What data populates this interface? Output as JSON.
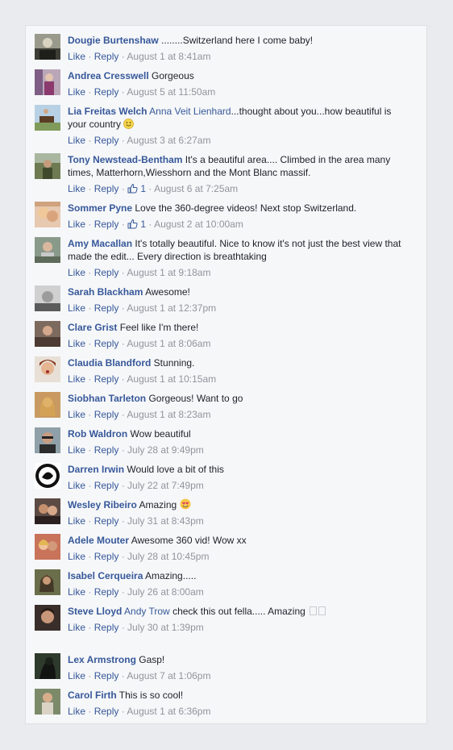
{
  "comments": [
    {
      "author": "Dougie Burtenshaw",
      "text": " ........Switzerland here I come baby!",
      "like": "Like",
      "reply": "Reply",
      "time": "August 1 at 8:41am"
    },
    {
      "author": "Andrea Cresswell",
      "text": " Gorgeous",
      "like": "Like",
      "reply": "Reply",
      "time": "August 5 at 11:50am"
    },
    {
      "author": "Lia Freitas Welch",
      "mention": "Anna Veit Lienhard",
      "text": "...thought about you...how beautiful is your country",
      "emoji": "smile-emoji",
      "like": "Like",
      "reply": "Reply",
      "time": "August 3 at 6:27am"
    },
    {
      "author": "Tony Newstead-Bentham",
      "text": " It's a beautiful area.... Climbed in the area many times, Matterhorn,Wiesshorn and the Mont Blanc massif.",
      "like": "Like",
      "reply": "Reply",
      "likes": "1",
      "time": "August 6 at 7:25am"
    },
    {
      "author": "Sommer Pyne",
      "text": " Love the 360-degree videos! Next stop Switzerland.",
      "like": "Like",
      "reply": "Reply",
      "likes": "1",
      "time": "August 2 at 10:00am"
    },
    {
      "author": "Amy Macallan",
      "text": " It's totally beautiful. Nice to know it's not just the best view that made the edit... Every direction is breathtaking",
      "like": "Like",
      "reply": "Reply",
      "time": "August 1 at 9:18am"
    },
    {
      "author": "Sarah Blackham",
      "text": " Awesome!",
      "like": "Like",
      "reply": "Reply",
      "time": "August 1 at 12:37pm"
    },
    {
      "author": "Clare Grist",
      "text": " Feel like I'm there!",
      "like": "Like",
      "reply": "Reply",
      "time": "August 1 at 8:06am"
    },
    {
      "author": "Claudia Blandford",
      "text": " Stunning.",
      "like": "Like",
      "reply": "Reply",
      "time": "August 1 at 10:15am"
    },
    {
      "author": "Siobhan Tarleton",
      "text": " Gorgeous! Want to go",
      "like": "Like",
      "reply": "Reply",
      "time": "August 1 at 8:23am"
    },
    {
      "author": "Rob Waldron",
      "text": " Wow beautiful",
      "like": "Like",
      "reply": "Reply",
      "time": "July 28 at 9:49pm"
    },
    {
      "author": "Darren Irwin",
      "text": " Would love a bit of this",
      "like": "Like",
      "reply": "Reply",
      "time": "July 22 at 7:49pm"
    },
    {
      "author": "Wesley Ribeiro",
      "text": " Amazing ",
      "emoji": "heart-eyes-emoji",
      "like": "Like",
      "reply": "Reply",
      "time": "July 31 at 8:43pm"
    },
    {
      "author": "Adele Mouter",
      "text": " Awesome 360 vid! Wow xx",
      "like": "Like",
      "reply": "Reply",
      "time": "July 28 at 10:45pm"
    },
    {
      "author": "Isabel Cerqueira",
      "text": " Amazing.....",
      "like": "Like",
      "reply": "Reply",
      "time": "July 26 at 8:00am"
    },
    {
      "author": "Steve Lloyd",
      "mention": "Andy Trow",
      "text": " check this out fella..... Amazing ",
      "like": "Like",
      "reply": "Reply",
      "time": "July 30 at 1:39pm"
    },
    {
      "author": "Lex Armstrong",
      "text": " Gasp!",
      "like": "Like",
      "reply": "Reply",
      "time": "August 7 at 1:06pm"
    },
    {
      "author": "Carol Firth",
      "text": " This is so cool!",
      "like": "Like",
      "reply": "Reply",
      "time": "August 1 at 6:36pm"
    }
  ],
  "colors": {
    "link": "#365899",
    "meta": "#90949c",
    "panel": "#f6f7f9",
    "page": "#e9ebee"
  }
}
